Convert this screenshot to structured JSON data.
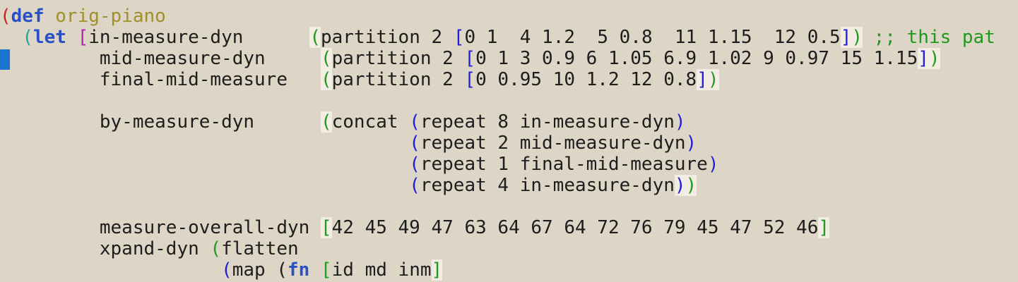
{
  "editor": {
    "language": "clojure",
    "lines": [
      {
        "tokens": [
          {
            "t": "(",
            "c": "p-red"
          },
          {
            "t": "def",
            "c": "kw"
          },
          {
            "t": " ",
            "c": ""
          },
          {
            "t": "orig-piano",
            "c": "fname"
          }
        ]
      },
      {
        "tokens": [
          {
            "t": "  ",
            "c": ""
          },
          {
            "t": "(",
            "c": "p-teal"
          },
          {
            "t": "let",
            "c": "kw"
          },
          {
            "t": " ",
            "c": ""
          },
          {
            "t": "[",
            "c": "p-magenta"
          },
          {
            "t": "in-measure-dyn      ",
            "c": ""
          },
          {
            "t": "(",
            "c": "p-green hl"
          },
          {
            "t": "partition 2 ",
            "c": ""
          },
          {
            "t": "[",
            "c": "p-blue"
          },
          {
            "t": "0 1  4 1.2  5 0.8  11 1.15  12 0.5",
            "c": ""
          },
          {
            "t": "]",
            "c": "p-blue hl"
          },
          {
            "t": ")",
            "c": "p-green hl"
          },
          {
            "t": " ",
            "c": ""
          },
          {
            "t": ";; this pat",
            "c": "comment"
          }
        ]
      },
      {
        "tokens": [
          {
            "t": "         mid-measure-dyn     ",
            "c": ""
          },
          {
            "t": "(",
            "c": "p-green hl"
          },
          {
            "t": "partition 2 ",
            "c": ""
          },
          {
            "t": "[",
            "c": "p-blue"
          },
          {
            "t": "0 1 3 0.9 6 1.05 6.9 1.02 9 0.97 15 1.15",
            "c": ""
          },
          {
            "t": "]",
            "c": "p-blue hl"
          },
          {
            "t": ")",
            "c": "p-green hl"
          }
        ]
      },
      {
        "tokens": [
          {
            "t": "         final-mid-measure   ",
            "c": ""
          },
          {
            "t": "(",
            "c": "p-green hl"
          },
          {
            "t": "partition 2 ",
            "c": ""
          },
          {
            "t": "[",
            "c": "p-blue"
          },
          {
            "t": "0 0.95 10 1.2 12 0.8",
            "c": ""
          },
          {
            "t": "]",
            "c": "p-blue hl"
          },
          {
            "t": ")",
            "c": "p-green hl"
          }
        ]
      },
      {
        "tokens": []
      },
      {
        "tokens": [
          {
            "t": "         by-measure-dyn      ",
            "c": ""
          },
          {
            "t": "(",
            "c": "p-green hl"
          },
          {
            "t": "concat ",
            "c": ""
          },
          {
            "t": "(",
            "c": "p-blue"
          },
          {
            "t": "repeat 8 in-measure-dyn",
            "c": ""
          },
          {
            "t": ")",
            "c": "p-blue"
          }
        ]
      },
      {
        "tokens": [
          {
            "t": "                                     ",
            "c": ""
          },
          {
            "t": "(",
            "c": "p-blue"
          },
          {
            "t": "repeat 2 mid-measure-dyn",
            "c": ""
          },
          {
            "t": ")",
            "c": "p-blue"
          }
        ]
      },
      {
        "tokens": [
          {
            "t": "                                     ",
            "c": ""
          },
          {
            "t": "(",
            "c": "p-blue"
          },
          {
            "t": "repeat 1 final-mid-measure",
            "c": ""
          },
          {
            "t": ")",
            "c": "p-blue"
          }
        ]
      },
      {
        "tokens": [
          {
            "t": "                                     ",
            "c": ""
          },
          {
            "t": "(",
            "c": "p-blue"
          },
          {
            "t": "repeat 4 in-measure-dyn",
            "c": ""
          },
          {
            "t": ")",
            "c": "p-blue hl"
          },
          {
            "t": ")",
            "c": "p-green hl"
          }
        ]
      },
      {
        "tokens": []
      },
      {
        "tokens": [
          {
            "t": "         measure-overall-dyn ",
            "c": ""
          },
          {
            "t": "[",
            "c": "p-green hl"
          },
          {
            "t": "42 45 49 47 63 64 67 64 72 76 79 45 47 52 46",
            "c": ""
          },
          {
            "t": "]",
            "c": "p-green hl"
          }
        ]
      },
      {
        "tokens": [
          {
            "t": "         xpand-dyn ",
            "c": ""
          },
          {
            "t": "(",
            "c": "p-green"
          },
          {
            "t": "flatten",
            "c": ""
          }
        ]
      },
      {
        "tokens": [
          {
            "t": "                    ",
            "c": ""
          },
          {
            "t": "(",
            "c": "p-blue"
          },
          {
            "t": "map ",
            "c": ""
          },
          {
            "t": "(",
            "c": ""
          },
          {
            "t": "fn",
            "c": "kw"
          },
          {
            "t": " ",
            "c": ""
          },
          {
            "t": "[",
            "c": "p-green"
          },
          {
            "t": "id md inm",
            "c": ""
          },
          {
            "t": "]",
            "c": "p-green hl"
          }
        ]
      }
    ]
  }
}
